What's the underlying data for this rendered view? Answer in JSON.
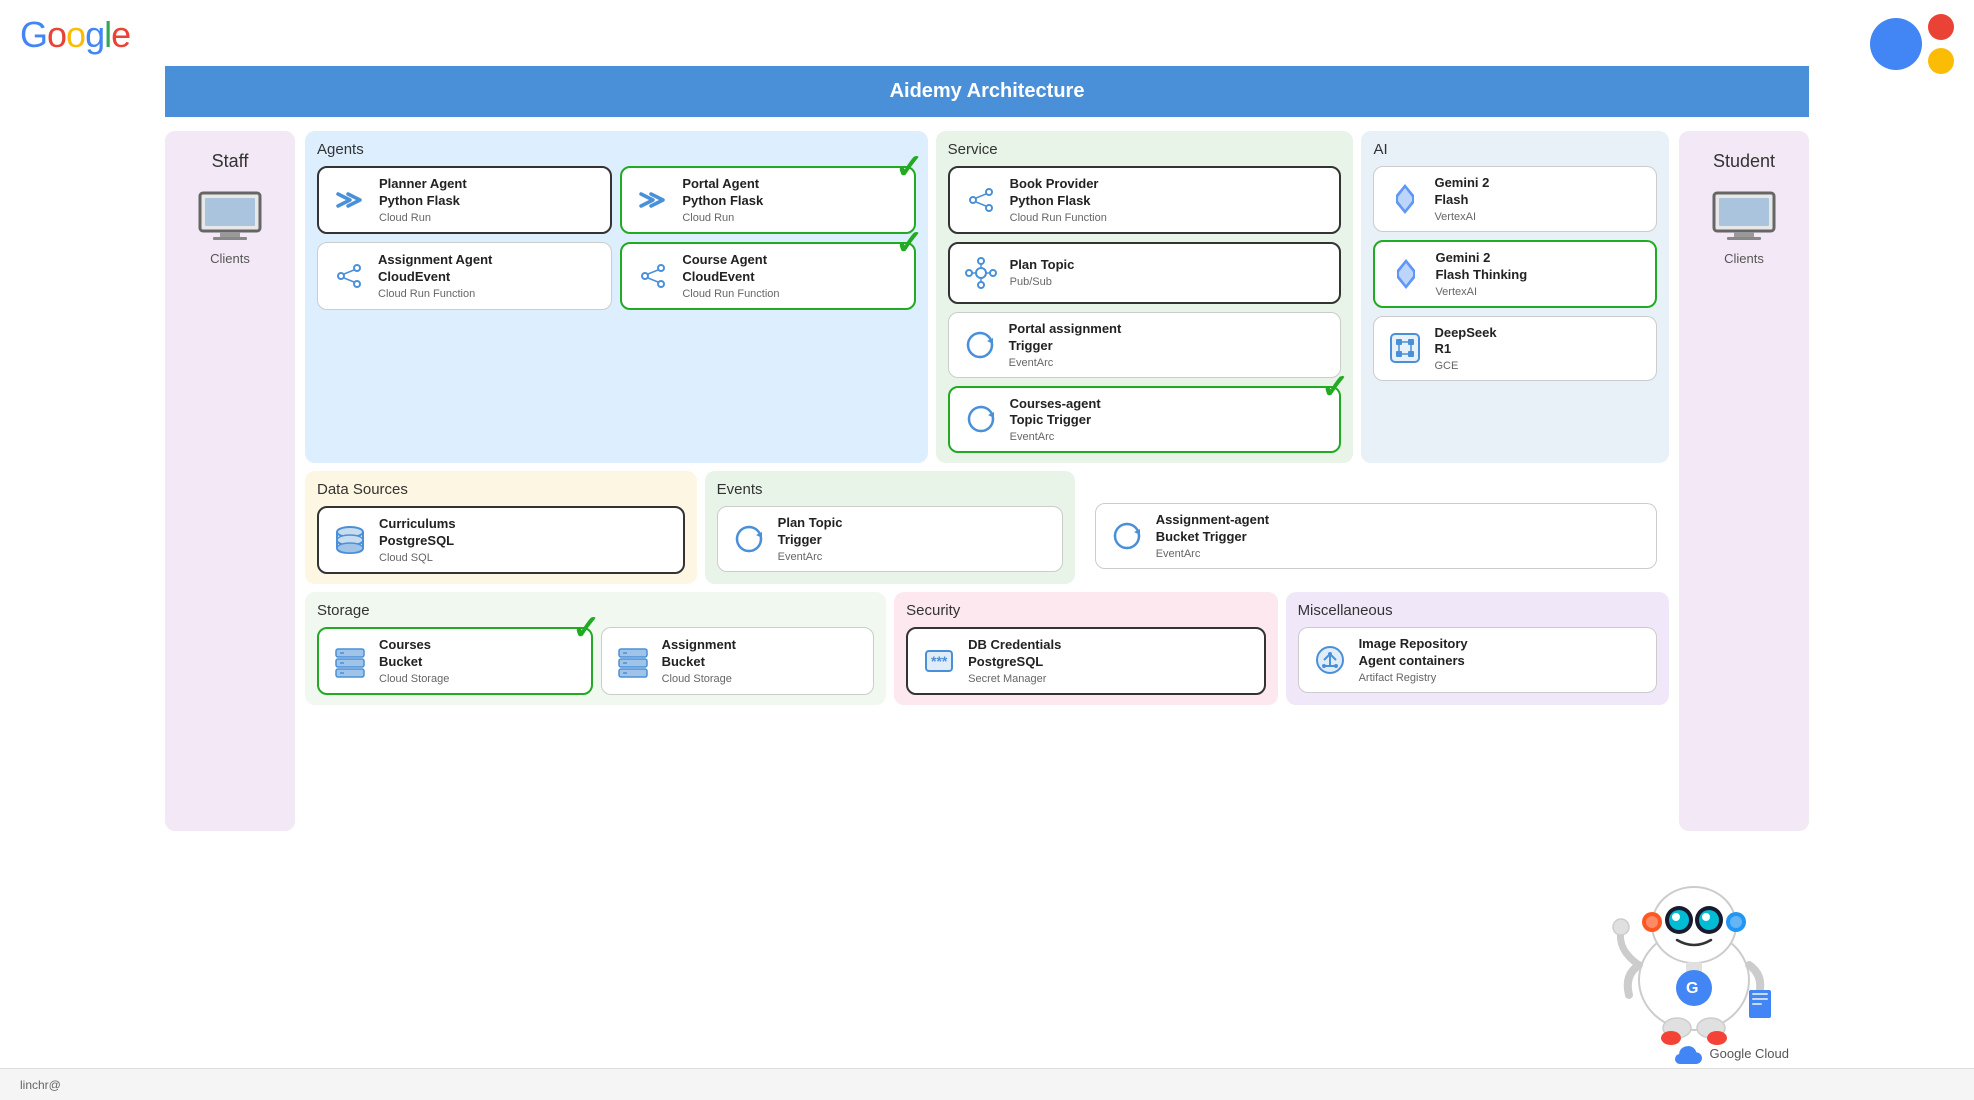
{
  "title": "Aidemy Architecture",
  "googleLogo": "Google",
  "header": {
    "title": "Aidemy Architecture"
  },
  "footer": {
    "user": "linchr@"
  },
  "googleCloud": "Google Cloud",
  "staff": {
    "label": "Staff",
    "clientLabel": "Clients"
  },
  "student": {
    "label": "Student",
    "clientLabel": "Clients"
  },
  "agents": {
    "sectionTitle": "Agents",
    "cards": [
      {
        "name": "Planner Agent Python Flask",
        "sub": "Cloud Run",
        "greenBorder": false,
        "darkBorder": true,
        "checkmark": false,
        "iconType": "chevrons"
      },
      {
        "name": "Portal Agent Python Flask",
        "sub": "Cloud Run",
        "greenBorder": true,
        "darkBorder": false,
        "checkmark": true,
        "iconType": "chevrons"
      },
      {
        "name": "Assignment Agent CloudEvent",
        "sub": "Cloud Run Function",
        "greenBorder": false,
        "darkBorder": false,
        "checkmark": false,
        "iconType": "dots"
      },
      {
        "name": "Course Agent CloudEvent",
        "sub": "Cloud Run Function",
        "greenBorder": true,
        "darkBorder": false,
        "checkmark": true,
        "iconType": "dots"
      }
    ]
  },
  "service": {
    "sectionTitle": "Service",
    "cards": [
      {
        "name": "Book Provider Python Flask",
        "sub": "Cloud Run Function",
        "greenBorder": false,
        "darkBorder": true,
        "checkmark": false,
        "iconType": "dots"
      },
      {
        "name": "Plan Topic",
        "sub": "Pub/Sub",
        "greenBorder": false,
        "darkBorder": true,
        "checkmark": false,
        "iconType": "network"
      },
      {
        "name": "Portal assignment Trigger",
        "sub": "EventArc",
        "greenBorder": false,
        "darkBorder": false,
        "checkmark": false,
        "iconType": "cycle"
      },
      {
        "name": "Courses-agent Topic Trigger",
        "sub": "EventArc",
        "greenBorder": true,
        "darkBorder": false,
        "checkmark": true,
        "iconType": "cycle"
      }
    ]
  },
  "ai": {
    "sectionTitle": "AI",
    "cards": [
      {
        "name": "Gemini 2 Flash",
        "sub": "VertexAI",
        "greenBorder": false,
        "darkBorder": false,
        "iconType": "diamond"
      },
      {
        "name": "Gemini 2 Flash Thinking",
        "sub": "VertexAI",
        "greenBorder": true,
        "darkBorder": false,
        "iconType": "diamond"
      },
      {
        "name": "DeepSeek R1",
        "sub": "GCE",
        "greenBorder": false,
        "darkBorder": false,
        "iconType": "chip"
      }
    ]
  },
  "dataSources": {
    "sectionTitle": "Data Sources",
    "cards": [
      {
        "name": "Curriculums PostgreSQL",
        "sub": "Cloud SQL",
        "darkBorder": true,
        "iconType": "db"
      }
    ]
  },
  "events": {
    "sectionTitle": "Events",
    "cards": [
      {
        "name": "Plan Topic Trigger",
        "sub": "EventArc",
        "darkBorder": false,
        "iconType": "cycle"
      }
    ]
  },
  "assignmentAgentTrigger": {
    "name": "Assignment-agent Bucket Trigger",
    "sub": "EventArc",
    "iconType": "cycle"
  },
  "storage": {
    "sectionTitle": "Storage",
    "cards": [
      {
        "name": "Courses Bucket",
        "sub": "Cloud Storage",
        "greenBorder": true,
        "darkBorder": false,
        "checkmark": true,
        "iconType": "storage"
      },
      {
        "name": "Assignment Bucket",
        "sub": "Cloud Storage",
        "greenBorder": false,
        "darkBorder": false,
        "iconType": "storage"
      }
    ]
  },
  "security": {
    "sectionTitle": "Security",
    "cards": [
      {
        "name": "DB Credentials PostgreSQL",
        "sub": "Secret Manager",
        "darkBorder": true,
        "iconType": "key"
      }
    ]
  },
  "misc": {
    "sectionTitle": "Miscellaneous",
    "cards": [
      {
        "name": "Image Repository Agent containers",
        "sub": "Artifact Registry",
        "darkBorder": false,
        "iconType": "artifact"
      }
    ]
  }
}
